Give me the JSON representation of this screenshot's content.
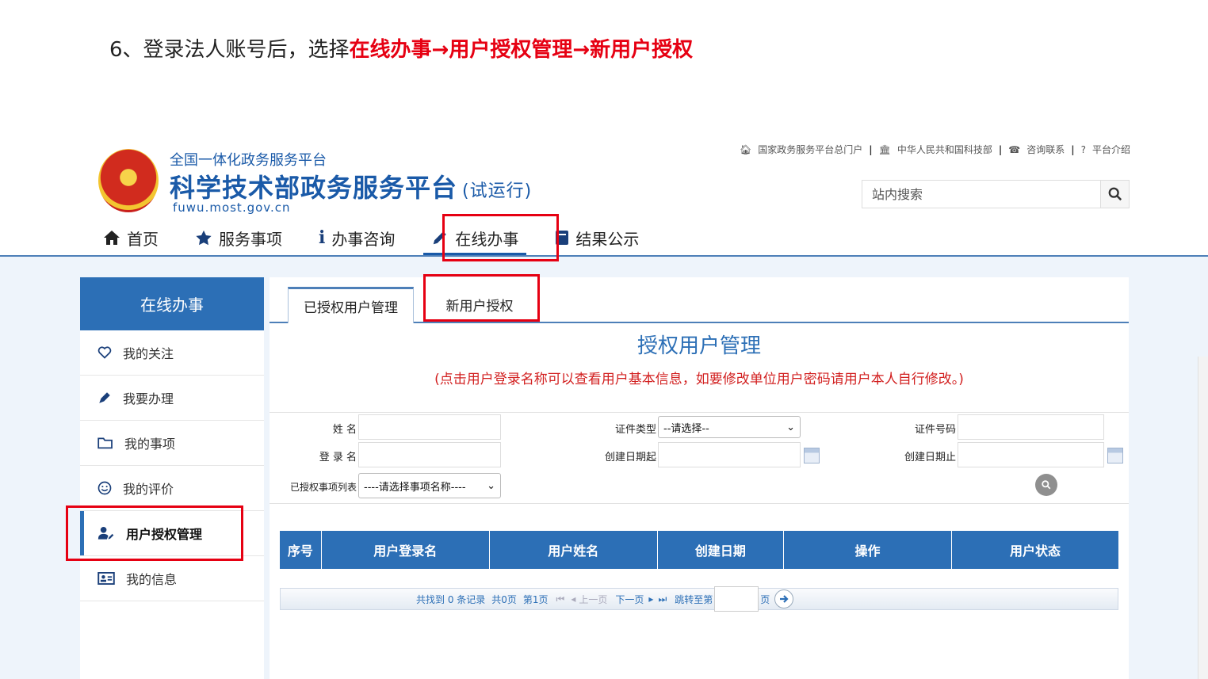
{
  "instruction": {
    "prefix": "6、登录法人账号后，选择",
    "highlight": "在线办事→用户授权管理→新用户授权"
  },
  "header": {
    "top_links": [
      {
        "icon": "home-icon",
        "label": "国家政务服务平台总门户"
      },
      {
        "icon": "building-icon",
        "label": "中华人民共和国科技部"
      },
      {
        "icon": "phone-icon",
        "label": "咨询联系"
      },
      {
        "icon": "question-icon",
        "label": "平台介绍"
      }
    ],
    "sub_title": "全国一体化政务服务平台",
    "main_title": "科学技术部政务服务平台",
    "trial": "(试运行)",
    "domain": "fuwu.most.gov.cn",
    "search_placeholder": "站内搜索"
  },
  "nav": [
    {
      "icon": "home-icon",
      "label": "首页"
    },
    {
      "icon": "star-icon",
      "label": "服务事项"
    },
    {
      "icon": "info-icon",
      "label": "办事咨询"
    },
    {
      "icon": "pencil-icon",
      "label": "在线办事",
      "active": true
    },
    {
      "icon": "book-icon",
      "label": "结果公示"
    }
  ],
  "sidebar": {
    "title": "在线办事",
    "items": [
      {
        "icon": "heart-icon",
        "label": "我的关注"
      },
      {
        "icon": "pen-icon",
        "label": "我要办理"
      },
      {
        "icon": "folder-icon",
        "label": "我的事项"
      },
      {
        "icon": "smile-icon",
        "label": "我的评价"
      },
      {
        "icon": "user-edit-icon",
        "label": "用户授权管理",
        "active": true
      },
      {
        "icon": "id-card-icon",
        "label": "我的信息"
      }
    ]
  },
  "tabs": {
    "authorized": "已授权用户管理",
    "new": "新用户授权"
  },
  "panel": {
    "title": "授权用户管理",
    "note": "(点击用户登录名称可以查看用户基本信息，如要修改单位用户密码请用户本人自行修改。)"
  },
  "filter": {
    "name_label": "姓    名",
    "cert_type_label": "证件类型",
    "cert_type_value": "--请选择--",
    "cert_no_label": "证件号码",
    "login_label": "登 录 名",
    "date_start_label": "创建日期起",
    "date_end_label": "创建日期止",
    "items_label": "已授权事项列表",
    "items_value": "----请选择事项名称----"
  },
  "table": {
    "columns": [
      "序号",
      "用户登录名",
      "用户姓名",
      "创建日期",
      "操作",
      "用户状态"
    ]
  },
  "pager": {
    "found": "共找到 0 条记录",
    "pages": "共0页",
    "current": "第1页",
    "prev": "上一页",
    "next": "下一页",
    "jump": "跳转至第",
    "page_unit": "页"
  },
  "colors": {
    "brand_blue": "#2c6fb6",
    "highlight_red": "#e60012"
  }
}
